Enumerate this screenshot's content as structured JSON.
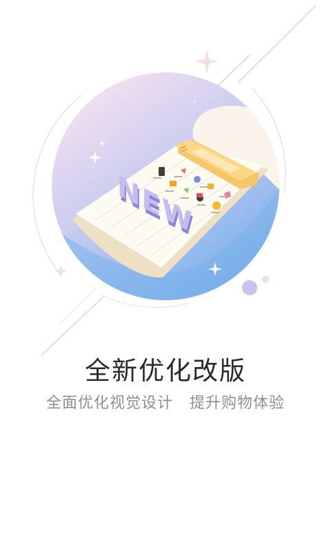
{
  "splash": {
    "title": "全新优化改版",
    "subtitle": "全面优化视觉设计   提升购物体验",
    "illustration": {
      "badge_text": "NEW",
      "colors": {
        "circle_top": "#f2dff0",
        "circle_bottom": "#79b1ec",
        "notebook_paper": "#fdfbf1",
        "notebook_header": "#fbd884",
        "badge_letters": "#bcb5ec"
      },
      "app_icons": [
        "phone-icon",
        "rocket-icon",
        "basket-icon",
        "hotel-icon",
        "gift-icon",
        "gem-icon",
        "bag-icon",
        "cart-icon",
        "game-icon",
        "smile-icon"
      ]
    }
  }
}
